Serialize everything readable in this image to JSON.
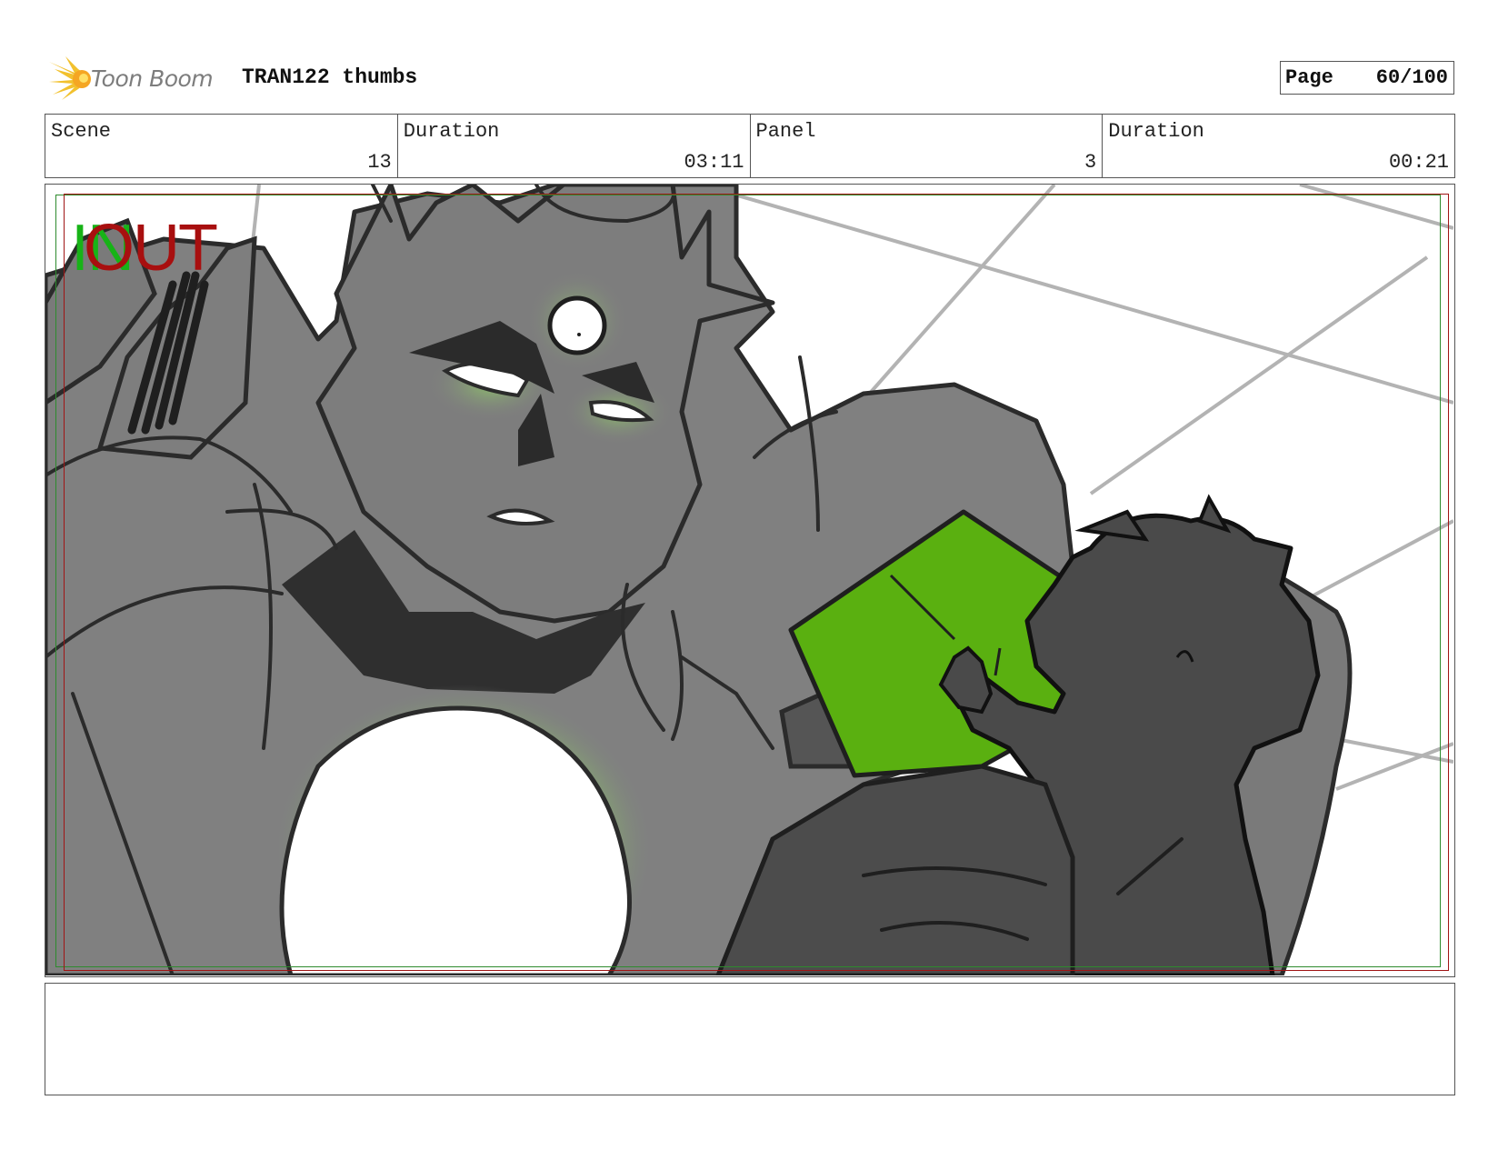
{
  "header": {
    "logo_text": "Toon Boom",
    "project_title": "TRAN122 thumbs",
    "page_label": "Page",
    "page_value": "60/100"
  },
  "info": {
    "scene_label": "Scene",
    "scene_value": "13",
    "scene_duration_label": "Duration",
    "scene_duration_value": "03:11",
    "panel_label": "Panel",
    "panel_value": "3",
    "panel_duration_label": "Duration",
    "panel_duration_value": "00:21"
  },
  "panel": {
    "in_mark": "IN",
    "out_mark": "OUT",
    "colors": {
      "in": "#17b317",
      "out": "#a80f0f",
      "accent_green": "#5ab010",
      "mid_gray": "#808080",
      "dark_gray": "#4a4a4a"
    }
  },
  "notes": {
    "text": ""
  }
}
